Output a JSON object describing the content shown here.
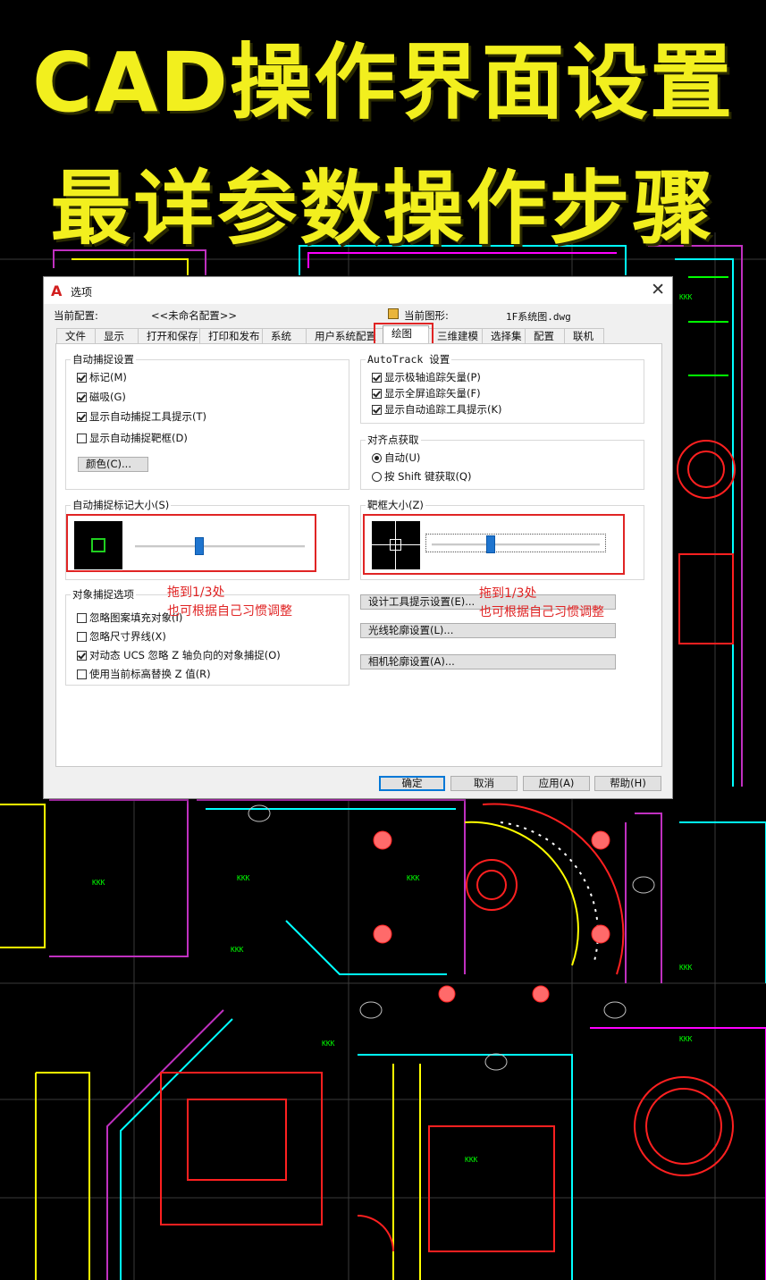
{
  "headline": {
    "line1": "CAD操作界面设置",
    "line2": "最详参数操作步骤"
  },
  "colors": {
    "headline": "#f2ef1e",
    "annotation": "#e02424",
    "slider_thumb": "#1f75cf"
  },
  "dialog": {
    "title": "选项",
    "current_profile_label": "当前配置:",
    "current_profile_value": "<<未命名配置>>",
    "current_drawing_label": "当前图形:",
    "current_drawing_value": "1F系统图.dwg",
    "tabs": [
      "文件",
      "显示",
      "打开和保存",
      "打印和发布",
      "系统",
      "用户系统配置",
      "绘图",
      "三维建模",
      "选择集",
      "配置",
      "联机"
    ],
    "active_tab": "绘图",
    "autosnap": {
      "title": "自动捕捉设置",
      "marker": "标记(M)",
      "magnet": "磁吸(G)",
      "tooltip": "显示自动捕捉工具提示(T)",
      "aperture": "显示自动捕捉靶框(D)",
      "color_button": "颜色(C)...",
      "checked": {
        "marker": true,
        "magnet": true,
        "tooltip": true,
        "aperture": false
      }
    },
    "autotrack": {
      "title": "AutoTrack 设置",
      "polar": "显示极轴追踪矢量(P)",
      "fullscreen": "显示全屏追踪矢量(F)",
      "tooltip": "显示自动追踪工具提示(K)",
      "checked": {
        "polar": true,
        "fullscreen": true,
        "tooltip": true
      }
    },
    "alignment": {
      "title": "对齐点获取",
      "auto": "自动(U)",
      "shift": "按 Shift 键获取(Q)",
      "selected": "auto"
    },
    "marker_size": {
      "title": "自动捕捉标记大小(S)",
      "slider_fraction": 0.38
    },
    "aperture_size": {
      "title": "靶框大小(Z)",
      "slider_fraction": 0.35
    },
    "object_snap": {
      "title": "对象捕捉选项",
      "ignore_hatch": "忽略图案填充对象(I)",
      "ignore_dim": "忽略尺寸界线(X)",
      "dynamic_ucs": "对动态 UCS 忽略 Z 轴负向的对象捕捉(O)",
      "replace_z": "使用当前标高替换 Z 值(R)",
      "checked": {
        "ignore_hatch": false,
        "ignore_dim": false,
        "dynamic_ucs": true,
        "replace_z": false
      }
    },
    "buttons": {
      "tooltip_settings": "设计工具提示设置(E)...",
      "lightglyph": "光线轮廓设置(L)...",
      "camera_glyph": "相机轮廓设置(A)...",
      "ok": "确定",
      "cancel": "取消",
      "apply": "应用(A)",
      "help": "帮助(H)"
    }
  },
  "annotations": {
    "left_line1": "拖到1/3处",
    "left_line2": "也可根据自己习惯调整",
    "right_line1": "拖到1/3处",
    "right_line2": "也可根据自己习惯调整"
  }
}
